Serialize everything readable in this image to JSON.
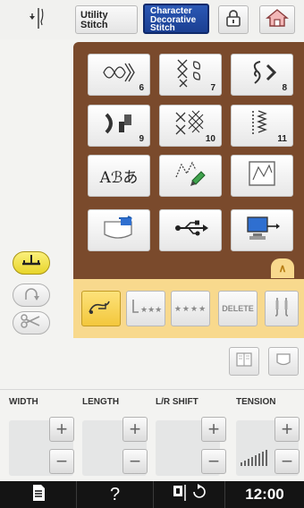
{
  "top_bar": {
    "utility_tab": "Utility\nStitch",
    "character_tab": "Character\nDecorative\nStitch"
  },
  "patterns": {
    "tiles": [
      {
        "name": "decorative-6",
        "number": "6"
      },
      {
        "name": "decorative-7",
        "number": "7"
      },
      {
        "name": "decorative-8",
        "number": "8"
      },
      {
        "name": "decorative-9",
        "number": "9"
      },
      {
        "name": "decorative-10",
        "number": "10"
      },
      {
        "name": "decorative-11",
        "number": "11"
      },
      {
        "name": "character-stitch",
        "label": "Aℬあ"
      },
      {
        "name": "myillust-draw",
        "number": ""
      },
      {
        "name": "myillust-edit",
        "number": ""
      },
      {
        "name": "pocket-memory",
        "number": ""
      },
      {
        "name": "usb-memory",
        "number": ""
      },
      {
        "name": "pc-memory",
        "number": ""
      }
    ]
  },
  "edit_strip": {
    "delete_label": "DELETE",
    "scroll_up": "∧"
  },
  "settings": {
    "width_label": "WIDTH",
    "length_label": "LENGTH",
    "lr_shift_label": "L/R SHIFT",
    "tension_label": "TENSION",
    "plus": "+",
    "minus": "−"
  },
  "bottom_bar": {
    "help": "?",
    "clock": "12:00"
  },
  "colors": {
    "panel_brown": "#7a4a2c",
    "strip_yellow": "#f8d98d",
    "tab_blue": "#1f4aa0",
    "side_active": "#f3e24a"
  }
}
